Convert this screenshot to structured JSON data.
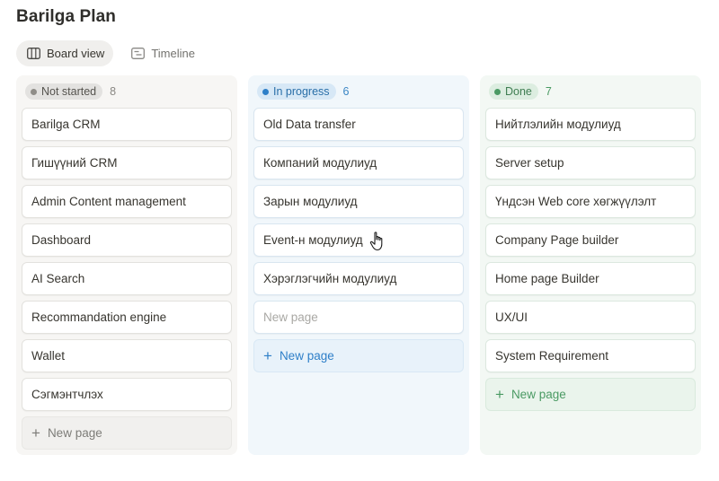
{
  "page": {
    "title": "Barilga Plan"
  },
  "tabs": [
    {
      "label": "Board view",
      "icon": "board-view-icon",
      "active": true
    },
    {
      "label": "Timeline",
      "icon": "timeline-icon",
      "active": false
    }
  ],
  "columns": {
    "not_started": {
      "status": "Not started",
      "count": "8",
      "color": "#8f8d88",
      "cards": [
        "Barilga CRM",
        "Гишүүний CRM",
        "Admin Content management",
        "Dashboard",
        "AI Search",
        "Recommandation engine",
        "Wallet",
        "Сэгмэнтчлэх"
      ],
      "new_page": "New page"
    },
    "in_progress": {
      "status": "In progress",
      "count": "6",
      "color": "#2e7fc8",
      "cards": [
        "Old Data transfer",
        "Компаний модулиуд",
        "Зарын модулиуд",
        "Event-н модулиуд",
        "Хэрэглэгчийн модулиуд"
      ],
      "placeholder_card": "New page",
      "new_page": "New page"
    },
    "done": {
      "status": "Done",
      "count": "7",
      "color": "#4a9a63",
      "cards": [
        "Нийтлэлийн модулиуд",
        "Server setup",
        "Үндсэн Web core хөгжүүлэлт",
        "Company Page builder",
        "Home page Builder",
        "UX/UI",
        "System Requirement"
      ],
      "new_page": "New page"
    }
  },
  "cursor": {
    "type": "hand-pointer-icon"
  }
}
